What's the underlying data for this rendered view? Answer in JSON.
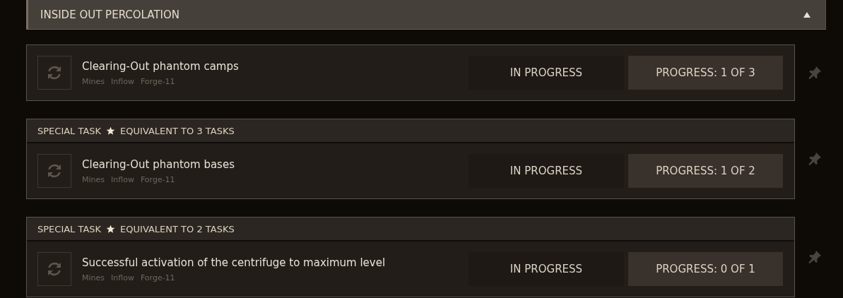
{
  "section": {
    "title": "INSIDE OUT PERCOLATION",
    "expanded": true
  },
  "tasks": [
    {
      "kind": "normal",
      "title": "Clearing-Out phantom camps",
      "tags": [
        "Mines",
        "Inflow",
        "Forge-11"
      ],
      "status": "IN PROGRESS",
      "progress": "PROGRESS: 1 OF 3"
    },
    {
      "kind": "special",
      "special_label": "SPECIAL TASK",
      "equivalent": "EQUIVALENT TO 3 TASKS",
      "title": "Clearing-Out phantom bases",
      "tags": [
        "Mines",
        "Inflow",
        "Forge-11"
      ],
      "status": "IN PROGRESS",
      "progress": "PROGRESS: 1 OF 2"
    },
    {
      "kind": "special",
      "special_label": "SPECIAL TASK",
      "equivalent": "EQUIVALENT TO 2 TASKS",
      "title": "Successful activation of the centrifuge to maximum level",
      "tags": [
        "Mines",
        "Inflow",
        "Forge-11"
      ],
      "status": "IN PROGRESS",
      "progress": "PROGRESS: 0 OF 1"
    }
  ]
}
